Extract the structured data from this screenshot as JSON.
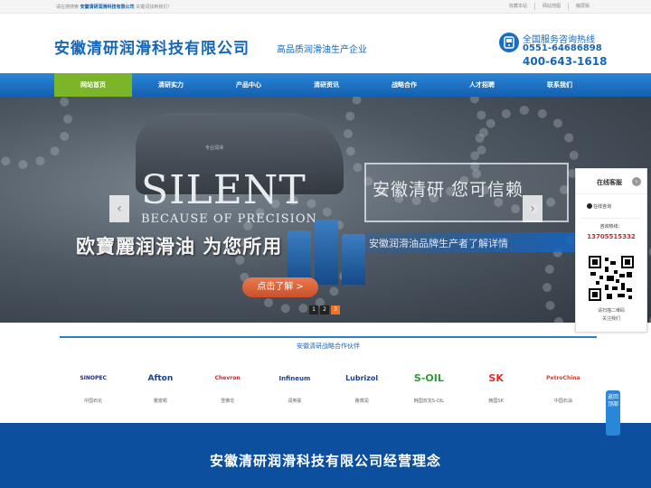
{
  "topbar": {
    "welcome_prefix": "请在搜搜索",
    "company": "安徽清研润滑科技有限公司",
    "welcome_suffix": "关键词找到我们！",
    "links": [
      "收藏本站",
      "网站地图",
      "触屏版"
    ]
  },
  "header": {
    "company_name": "安徽清研润滑科技有限公司",
    "slogan": "高品质润滑油生产企业",
    "hotline_label": "全国服务咨询热线",
    "hotline_1": "0551-64686898",
    "hotline_2": "400-643-1618"
  },
  "nav": {
    "items": [
      "网站首页",
      "清研实力",
      "产品中心",
      "清研资讯",
      "战略合作",
      "人才招聘",
      "联系我们"
    ],
    "active_index": 0
  },
  "banner": {
    "car_tag": "专业润滑",
    "headline_en": "SILENT",
    "subline_en": "BECAUSE OF PRECISION",
    "headline_cn": "欧寶麗润滑油 为您所用",
    "trust_text": "安徽清研 您可信赖",
    "brand_text": "安徽润滑油品牌生产者了解详情",
    "cta_label": "点击了解 >",
    "prev_icon": "chevron-left-icon",
    "next_icon": "chevron-right-icon",
    "pages": [
      "1",
      "2",
      "3"
    ],
    "active_page": 2
  },
  "partners": {
    "title": "安徽清研战略合作伙伴",
    "items": [
      {
        "logo": "SINOPEC",
        "name": "中国石化",
        "color": "#1d2c80"
      },
      {
        "logo": "Afton",
        "name": "雅富顿",
        "color": "#1e3f8c"
      },
      {
        "logo": "Chevron",
        "name": "雪佛龙",
        "color": "#d2232a"
      },
      {
        "logo": "Infineum",
        "name": "润英联",
        "color": "#1f3f91"
      },
      {
        "logo": "Lubrizol",
        "name": "路博润",
        "color": "#1e3f8c"
      },
      {
        "logo": "S-OIL",
        "name": "韩国双龙S-OIL",
        "color": "#2e9a3a"
      },
      {
        "logo": "SK",
        "name": "韩国SK",
        "color": "#e22b2b"
      },
      {
        "logo": "PetroChina",
        "name": "中国石油",
        "color": "#e23b1d"
      }
    ]
  },
  "band": {
    "text": "安徽清研润滑科技有限公司经营理念"
  },
  "service": {
    "title": "在线客服",
    "qq_label": "在线咨询",
    "hotline_label": "咨询热线：",
    "hotline_number": "13705515332",
    "qr_text_1": "请扫描二维码",
    "qr_text_2": "关注我们",
    "back_label": "返回顶部"
  },
  "colors": {
    "brand_blue": "#1667b8",
    "nav_active": "#7cb527",
    "band_bg": "#0c4f9e"
  }
}
